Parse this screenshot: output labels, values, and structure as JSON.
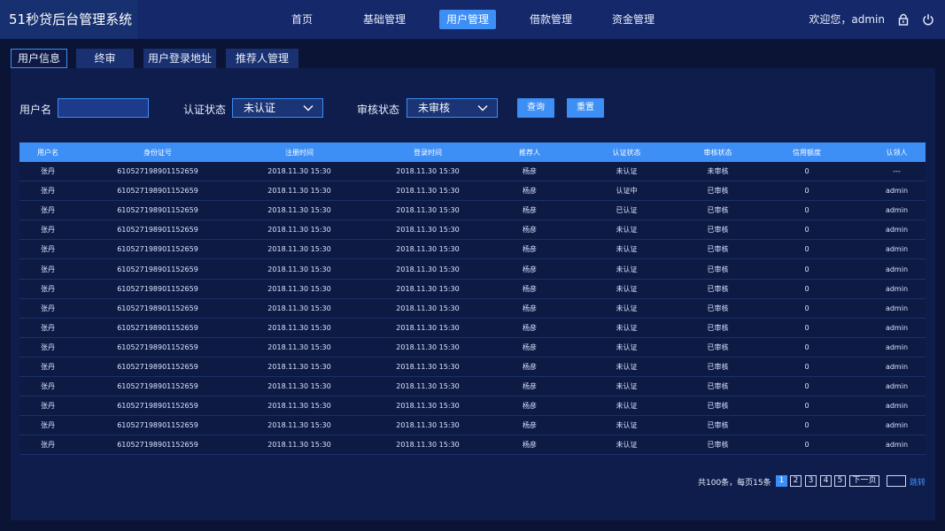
{
  "app": {
    "title": "51秒贷后台管理系统"
  },
  "nav": {
    "items": [
      {
        "label": "首页",
        "active": false
      },
      {
        "label": "基础管理",
        "active": false
      },
      {
        "label": "用户管理",
        "active": true
      },
      {
        "label": "借款管理",
        "active": false
      },
      {
        "label": "资金管理",
        "active": false
      }
    ]
  },
  "header": {
    "welcome": "欢迎您，admin",
    "icons": [
      "lock-icon",
      "power-icon"
    ]
  },
  "subtabs": [
    {
      "label": "用户信息",
      "active": true
    },
    {
      "label": "终审",
      "active": false
    },
    {
      "label": "用户登录地址",
      "active": false
    },
    {
      "label": "推荐人管理",
      "active": false
    }
  ],
  "filters": {
    "username_label": "用户名",
    "username_value": "",
    "cert_label": "认证状态",
    "cert_value": "未认证",
    "audit_label": "审核状态",
    "audit_value": "未审核",
    "query_label": "查询",
    "reset_label": "重置"
  },
  "table": {
    "columns": [
      "用户名",
      "身份证号",
      "注册时间",
      "登录时间",
      "推荐人",
      "认证状态",
      "审核状态",
      "信用额度",
      "认领人"
    ],
    "rows": [
      [
        "张丹",
        "610527198901152659",
        "2018.11.30 15:30",
        "2018.11.30 15:30",
        "杨彦",
        "未认证",
        "未审核",
        "0",
        "---"
      ],
      [
        "张丹",
        "610527198901152659",
        "2018.11.30 15:30",
        "2018.11.30 15:30",
        "杨彦",
        "认证中",
        "已审核",
        "0",
        "admin"
      ],
      [
        "张丹",
        "610527198901152659",
        "2018.11.30 15:30",
        "2018.11.30 15:30",
        "杨彦",
        "已认证",
        "已审核",
        "0",
        "admin"
      ],
      [
        "张丹",
        "610527198901152659",
        "2018.11.30 15:30",
        "2018.11.30 15:30",
        "杨彦",
        "未认证",
        "已审核",
        "0",
        "admin"
      ],
      [
        "张丹",
        "610527198901152659",
        "2018.11.30 15:30",
        "2018.11.30 15:30",
        "杨彦",
        "未认证",
        "已审核",
        "0",
        "admin"
      ],
      [
        "张丹",
        "610527198901152659",
        "2018.11.30 15:30",
        "2018.11.30 15:30",
        "杨彦",
        "未认证",
        "已审核",
        "0",
        "admin"
      ],
      [
        "张丹",
        "610527198901152659",
        "2018.11.30 15:30",
        "2018.11.30 15:30",
        "杨彦",
        "未认证",
        "已审核",
        "0",
        "admin"
      ],
      [
        "张丹",
        "610527198901152659",
        "2018.11.30 15:30",
        "2018.11.30 15:30",
        "杨彦",
        "未认证",
        "已审核",
        "0",
        "admin"
      ],
      [
        "张丹",
        "610527198901152659",
        "2018.11.30 15:30",
        "2018.11.30 15:30",
        "杨彦",
        "未认证",
        "已审核",
        "0",
        "admin"
      ],
      [
        "张丹",
        "610527198901152659",
        "2018.11.30 15:30",
        "2018.11.30 15:30",
        "杨彦",
        "未认证",
        "已审核",
        "0",
        "admin"
      ],
      [
        "张丹",
        "610527198901152659",
        "2018.11.30 15:30",
        "2018.11.30 15:30",
        "杨彦",
        "未认证",
        "已审核",
        "0",
        "admin"
      ],
      [
        "张丹",
        "610527198901152659",
        "2018.11.30 15:30",
        "2018.11.30 15:30",
        "杨彦",
        "未认证",
        "已审核",
        "0",
        "admin"
      ],
      [
        "张丹",
        "610527198901152659",
        "2018.11.30 15:30",
        "2018.11.30 15:30",
        "杨彦",
        "未认证",
        "已审核",
        "0",
        "admin"
      ],
      [
        "张丹",
        "610527198901152659",
        "2018.11.30 15:30",
        "2018.11.30 15:30",
        "杨彦",
        "未认证",
        "已审核",
        "0",
        "admin"
      ],
      [
        "张丹",
        "610527198901152659",
        "2018.11.30 15:30",
        "2018.11.30 15:30",
        "杨彦",
        "未认证",
        "已审核",
        "0",
        "admin"
      ]
    ]
  },
  "pagination": {
    "summary": "共100条，每页15条",
    "pages": [
      "1",
      "2",
      "3",
      "4",
      "5"
    ],
    "current": "1",
    "next_label": "下一页",
    "jump_value": "",
    "jump_label": "跳转"
  },
  "colors": {
    "accent": "#3d8ef5",
    "background": "#0b1434",
    "topbar": "#15296a"
  }
}
